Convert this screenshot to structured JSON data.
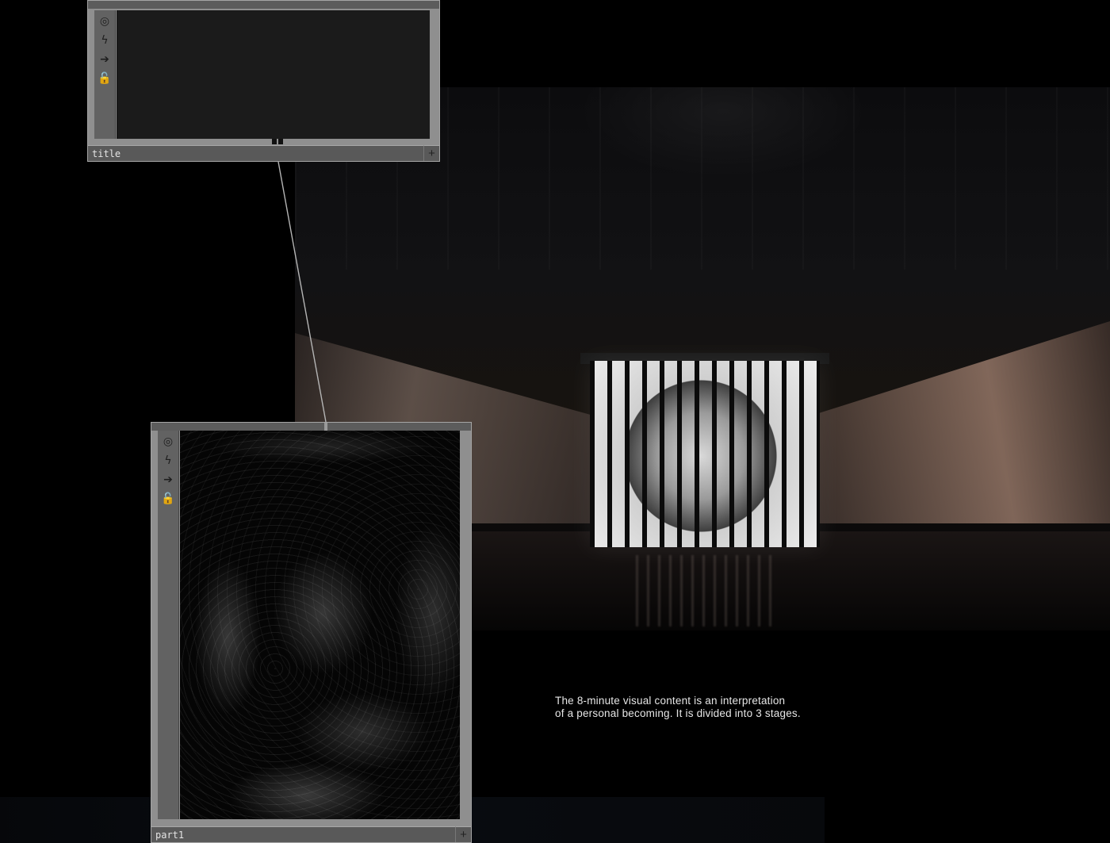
{
  "background": {
    "photo_name": "installation-hall-photo",
    "strip_name": "lower-photo-strip"
  },
  "nodes": [
    {
      "id": "node-title",
      "name": "title",
      "icons": [
        "viewer-icon",
        "bypass-icon",
        "export-icon",
        "lock-icon"
      ],
      "add_symbol": "+"
    },
    {
      "id": "node-part1",
      "name": "part1",
      "icons": [
        "viewer-icon",
        "bypass-icon",
        "export-icon",
        "lock-icon"
      ],
      "add_symbol": "+"
    }
  ],
  "caption": {
    "line1": "The 8-minute visual content is an interpretation",
    "line2": "of a personal becoming. It is divided into 3 stages."
  },
  "colors": {
    "node_frame": "#8f8f8f",
    "node_side": "#626262",
    "node_label_bar": "#595959",
    "wire": "#b5b5b5",
    "caption_text": "#e6e6e6"
  }
}
